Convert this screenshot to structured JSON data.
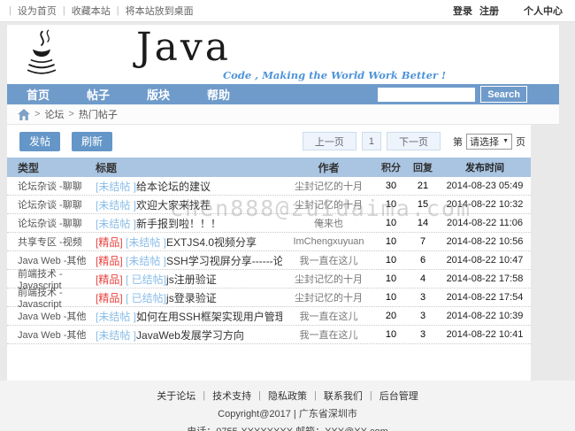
{
  "topbar": {
    "separator": "|",
    "left_links": [
      "设为首页",
      "收藏本站",
      "将本站放到桌面"
    ],
    "right_links": [
      "登录",
      "注册",
      "个人中心"
    ]
  },
  "header": {
    "logo_text": "Java",
    "tagline": "Code , Making the World Work Better !"
  },
  "nav": {
    "items": [
      "首页",
      "帖子",
      "版块",
      "帮助"
    ],
    "search_button": "Search"
  },
  "breadcrumb": {
    "separator": ">",
    "items": [
      "论坛",
      "热门帖子"
    ]
  },
  "toolbar": {
    "post_button": "发帖",
    "refresh_button": "刷新",
    "prev_button": "上一页",
    "current_page": "1",
    "next_button": "下一页",
    "jump_prefix": "第",
    "jump_select_value": "请选择",
    "jump_suffix": "页"
  },
  "icons": {
    "caret_down": "▼"
  },
  "table": {
    "columns": [
      "类型",
      "标题",
      "作者",
      "积分",
      "回复",
      "发布时间"
    ],
    "rows": [
      {
        "type": "论坛杂谈 -聊聊",
        "tag_premium": "",
        "tag_status": "[未结帖 ]",
        "title": "给本论坛的建议",
        "author": "尘封记忆的十月",
        "points": "30",
        "replies": "21",
        "time": "2014-08-23 05:49"
      },
      {
        "type": "论坛杂谈 -聊聊",
        "tag_premium": "",
        "tag_status": "[未结帖 ]",
        "title": "欢迎大家来找茬",
        "author": "尘封记忆的十月",
        "points": "10",
        "replies": "15",
        "time": "2014-08-22 10:32"
      },
      {
        "type": "论坛杂谈 -聊聊",
        "tag_premium": "",
        "tag_status": "[未结帖 ]",
        "title": "新手报到啦！！！",
        "author": "俺来也",
        "points": "10",
        "replies": "14",
        "time": "2014-08-22 11:06"
      },
      {
        "type": "共享专区 -视频",
        "tag_premium": "[精品] ",
        "tag_status": "[未结帖 ]",
        "title": "EXTJS4.0视频分享",
        "author": "ImChengxuyuan",
        "points": "10",
        "replies": "7",
        "time": "2014-08-22 10:56"
      },
      {
        "type": "Java Web -其他",
        "tag_premium": "[精品] ",
        "tag_status": "[未结帖 ]",
        "title": "SSH学习视屏分享------论坛开张推出的优惠哦 ...",
        "author": "我一直在这儿",
        "points": "10",
        "replies": "6",
        "time": "2014-08-22 10:47"
      },
      {
        "type": "前端技术 -Javascript",
        "tag_premium": "[精品] ",
        "tag_status": "[ 已结帖]",
        "title": "js注册验证",
        "author": "尘封记忆的十月",
        "points": "10",
        "replies": "4",
        "time": "2014-08-22 17:58"
      },
      {
        "type": "前端技术 -Javascript",
        "tag_premium": "[精品] ",
        "tag_status": "[ 已结帖]",
        "title": "js登录验证",
        "author": "尘封记忆的十月",
        "points": "10",
        "replies": "3",
        "time": "2014-08-22 17:54"
      },
      {
        "type": "Java Web -其他",
        "tag_premium": "",
        "tag_status": "[未结帖 ]",
        "title": "如何在用SSH框架实现用户管理系统时，在登录界面...",
        "author": "我一直在这儿",
        "points": "20",
        "replies": "3",
        "time": "2014-08-22 10:39"
      },
      {
        "type": "Java Web -其他",
        "tag_premium": "",
        "tag_status": "[未结帖 ]",
        "title": "JavaWeb发展学习方向",
        "author": "我一直在这儿",
        "points": "10",
        "replies": "3",
        "time": "2014-08-22 10:41"
      }
    ]
  },
  "watermark": "chen888@zuidaima.com",
  "footer": {
    "separator": "|",
    "links": [
      "关于论坛",
      "技术支持",
      "隐私政策",
      "联系我们",
      "后台管理"
    ],
    "copyright": "Copyright@2017 | 广东省深圳市",
    "contact": "电话：0755-XXXXXXXX 邮箱：XXX@XX.com"
  },
  "colors": {
    "nav_blue": "#6f9bca",
    "table_header_blue": "#a9c5e2",
    "tag_blue": "#8abde8",
    "tag_red": "#e8433f",
    "tagline_blue": "#4f94d8"
  }
}
